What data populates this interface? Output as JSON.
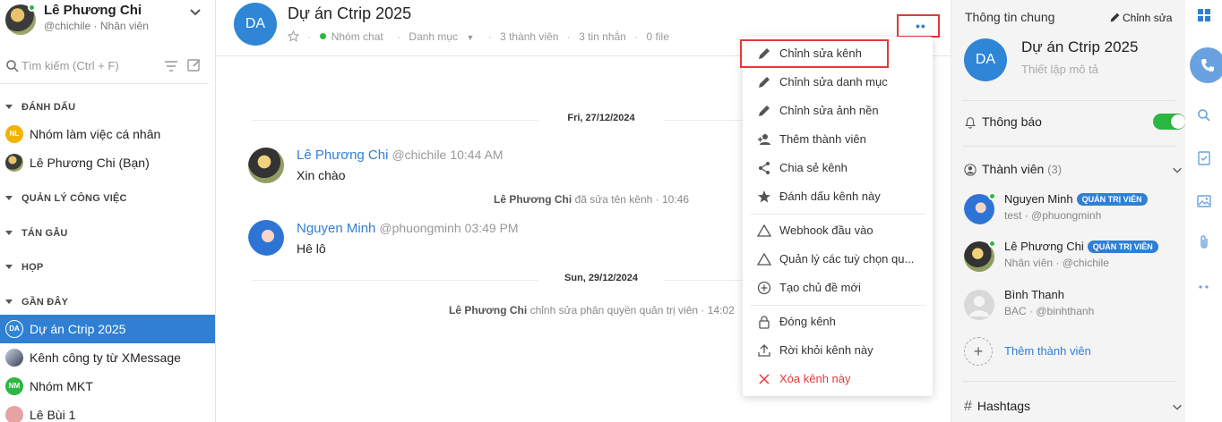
{
  "user": {
    "name": "Lê Phương Chi",
    "subtitle": "@chichile · Nhân viên"
  },
  "search": {
    "placeholder": "Tìm kiếm (Ctrl + F)"
  },
  "sidebar": {
    "sections": {
      "bookmarked": "ĐÁNH DẤU",
      "work": "QUẢN LÝ CÔNG VIỆC",
      "chat": "TÁN GẪU",
      "meeting": "HỌP",
      "recent": "GẦN ĐÂY"
    },
    "bookmarked_items": [
      {
        "initials": "NL",
        "label": "Nhóm làm việc cá nhân",
        "color": "#f0b400"
      },
      {
        "initials": "",
        "label": "Lê Phương Chi (Bạn)",
        "color": "#6b6b3b"
      }
    ],
    "recent_items": [
      {
        "initials": "DA",
        "label": "Dự án Ctrip 2025",
        "color": "#2f86d6",
        "active": true
      },
      {
        "initials": "",
        "label": "Kênh công ty từ XMessage",
        "color": "#445"
      },
      {
        "initials": "NM",
        "label": "Nhóm MKT",
        "color": "#2bb741"
      },
      {
        "initials": "",
        "label": "Lê Bùi 1",
        "color": "#e6a3a3"
      }
    ]
  },
  "channel": {
    "initials": "DA",
    "title": "Dự án Ctrip 2025",
    "type": "Nhóm chat",
    "category": "Danh mục",
    "members": "3 thành viên",
    "messages": "3 tin nhắn",
    "files": "0 file",
    "more_dots": "••"
  },
  "messages": {
    "date1": "Fri, 27/12/2024",
    "date2": "Sun, 29/12/2024",
    "m1": {
      "name": "Lê Phương Chi",
      "handle": "@chichile",
      "time": "10:44 AM",
      "text": "Xin chào"
    },
    "sys1": {
      "actor": "Lê Phương Chi",
      "text": "đã sửa tên kênh · 10:46"
    },
    "m2": {
      "name": "Nguyen Minh",
      "handle": "@phuongminh",
      "time": "03:49 PM",
      "text": "Hê lô"
    },
    "sys2": {
      "actor": "Lê Phương Chi",
      "text": "chỉnh sửa phân quyền quản trị viên · 14:02"
    }
  },
  "menu": {
    "edit_channel": "Chỉnh sửa kênh",
    "edit_category": "Chỉnh sửa danh mục",
    "edit_background": "Chỉnh sửa ảnh nền",
    "add_member": "Thêm thành viên",
    "share_channel": "Chia sẻ kênh",
    "bookmark": "Đánh dấu kênh này",
    "webhook": "Webhook đầu vào",
    "manage_options": "Quản lý các tuỳ chọn qu...",
    "new_topic": "Tạo chủ đề mới",
    "close_channel": "Đóng kênh",
    "leave_channel": "Rời khỏi kênh này",
    "delete_channel": "Xóa kênh này"
  },
  "info": {
    "title": "Thông tin chung",
    "edit": "Chỉnh sửa",
    "initials": "DA",
    "name": "Dự án Ctrip 2025",
    "desc": "Thiết lập mô tả",
    "notify": "Thông báo",
    "members_label": "Thành viên",
    "members_count": "(3)",
    "members": [
      {
        "name": "Nguyen Minh",
        "badge": "QUẢN TRỊ VIÊN",
        "sub": "test · @phuongminh"
      },
      {
        "name": "Lê Phương Chi",
        "badge": "QUẢN TRỊ VIÊN",
        "sub": "Nhân viên · @chichile"
      },
      {
        "name": "Bình Thanh",
        "badge": "",
        "sub": "BAC · @binhthanh"
      }
    ],
    "add_member": "Thêm thành viên",
    "add_plus": "+",
    "hashtags": "Hashtags"
  }
}
